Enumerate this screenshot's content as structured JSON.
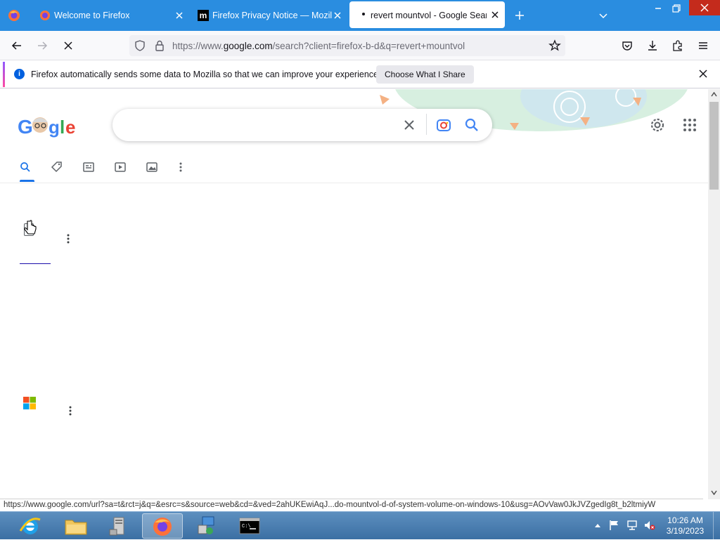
{
  "tabs": [
    {
      "label": "Welcome to Firefox"
    },
    {
      "label": "Firefox Privacy Notice — Mozilla"
    },
    {
      "label": "revert mountvol - Google Search"
    }
  ],
  "url": {
    "prefix": "https://www.",
    "domain": "google.com",
    "rest": "/search?client=firefox-b-d&q=revert+mountvol"
  },
  "notification": {
    "message": "Firefox automatically sends some data to Mozilla so that we can improve your experience.",
    "button": "Choose What I Share"
  },
  "status_url": "https://www.google.com/url?sa=t&rct=j&q=&esrc=s&source=web&cd=&ved=2ahUKEwiAqJ...do-mountvol-d-of-system-volume-on-windows-10&usg=AOvVaw0JkJVZgedIg8t_b2ltmiyW",
  "clock": {
    "time": "10:26 AM",
    "date": "3/19/2023"
  },
  "colors": {
    "accent": "#1a73e8",
    "titlebar": "#2a8de0"
  }
}
